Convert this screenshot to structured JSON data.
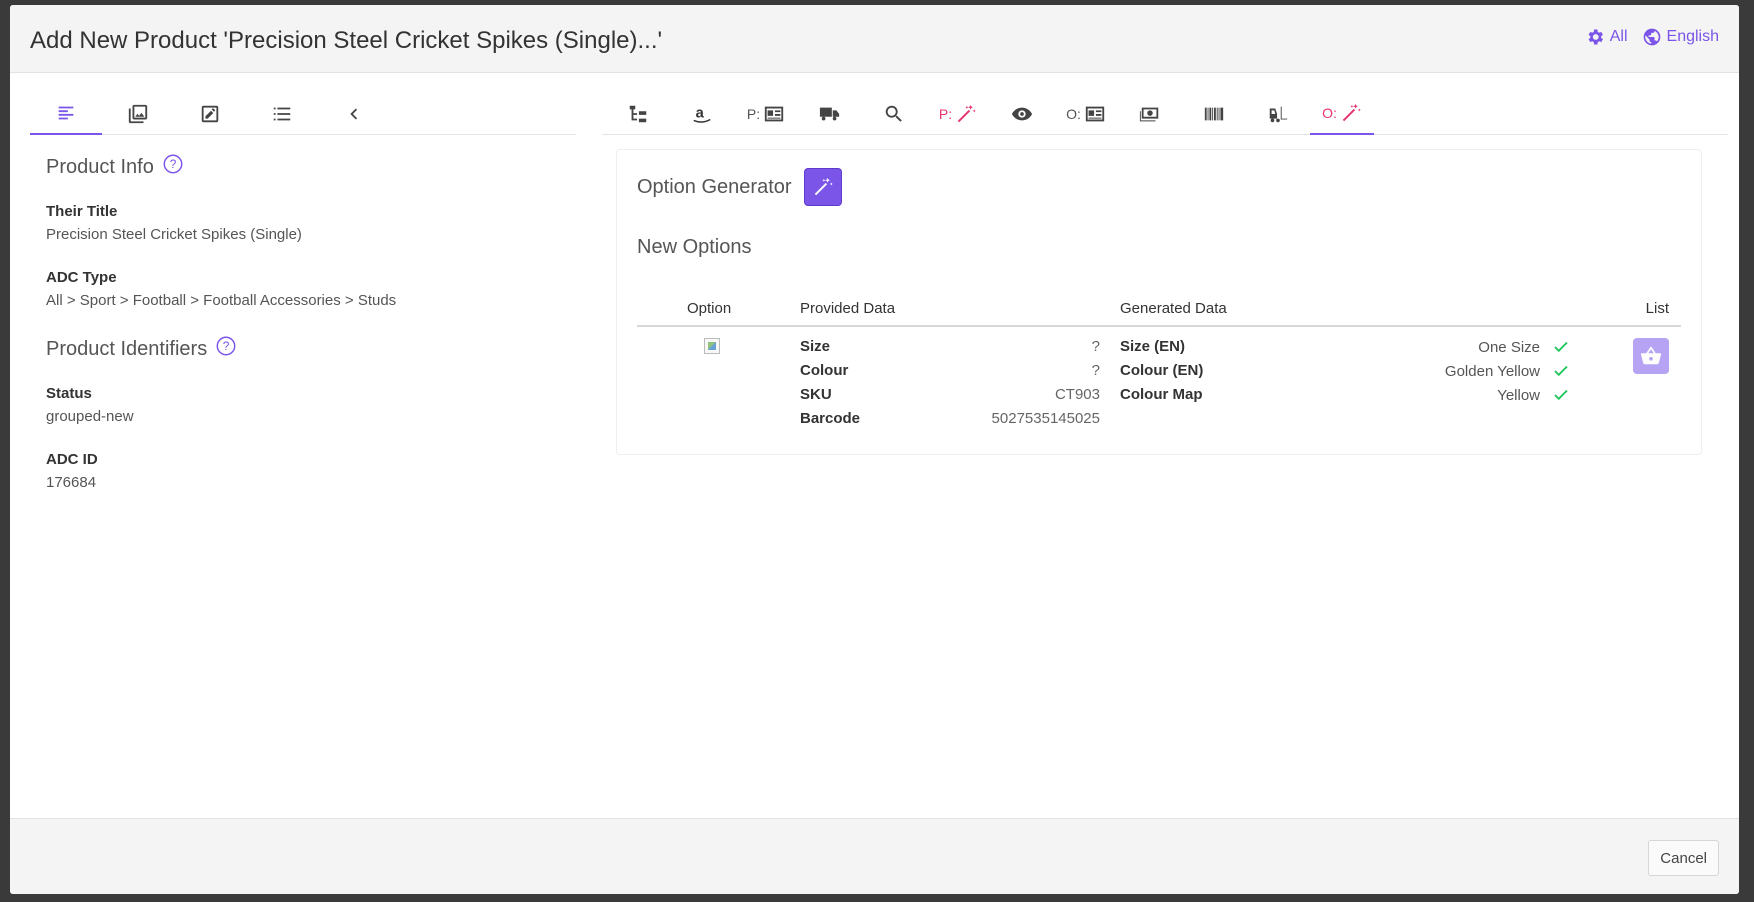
{
  "header": {
    "title": "Add New Product 'Precision Steel Cricket Spikes (Single)...'",
    "scope_label": "All",
    "language_label": "English"
  },
  "left_tabs": [
    {
      "icon": "text-lines-icon"
    },
    {
      "icon": "images-icon"
    },
    {
      "icon": "edit-icon"
    },
    {
      "icon": "list-icon"
    },
    {
      "icon": "chevron-left-icon"
    }
  ],
  "right_tabs": [
    {
      "prefix": "",
      "icon": "tree-icon"
    },
    {
      "prefix": "",
      "icon": "amazon-icon"
    },
    {
      "prefix": "P:",
      "icon": "listing-icon"
    },
    {
      "prefix": "",
      "icon": "truck-icon"
    },
    {
      "prefix": "",
      "icon": "search-icon"
    },
    {
      "prefix": "P:",
      "icon": "magic-wand-icon"
    },
    {
      "prefix": "",
      "icon": "eye-icon"
    },
    {
      "prefix": "O:",
      "icon": "listing-icon"
    },
    {
      "prefix": "",
      "icon": "money-icon"
    },
    {
      "prefix": "",
      "icon": "barcode-icon"
    },
    {
      "prefix": "",
      "icon": "forklift-icon"
    },
    {
      "prefix": "O:",
      "icon": "magic-wand-icon"
    }
  ],
  "product_info": {
    "title": "Product Info",
    "their_title_label": "Their Title",
    "their_title_value": "Precision Steel Cricket Spikes (Single)",
    "adc_type_label": "ADC Type",
    "adc_type_value": "All > Sport > Football > Football Accessories > Studs"
  },
  "product_identifiers": {
    "title": "Product Identifiers",
    "status_label": "Status",
    "status_value": "grouped-new",
    "adc_id_label": "ADC ID",
    "adc_id_value": "176684"
  },
  "option_generator": {
    "title": "Option Generator",
    "new_options_title": "New Options",
    "columns": {
      "option": "Option",
      "provided": "Provided Data",
      "generated": "Generated Data",
      "list": "List"
    },
    "provided": [
      {
        "key": "Size",
        "value": "?"
      },
      {
        "key": "Colour",
        "value": "?"
      },
      {
        "key": "SKU",
        "value": "CT903"
      },
      {
        "key": "Barcode",
        "value": "5027535145025"
      }
    ],
    "generated": [
      {
        "key": "Size (EN)",
        "value": "One Size"
      },
      {
        "key": "Colour (EN)",
        "value": "Golden Yellow"
      },
      {
        "key": "Colour Map",
        "value": "Yellow"
      }
    ]
  },
  "footer": {
    "cancel_label": "Cancel"
  },
  "colors": {
    "accent": "#7b55e8",
    "pink": "#e8336e",
    "check": "#22c55e"
  }
}
